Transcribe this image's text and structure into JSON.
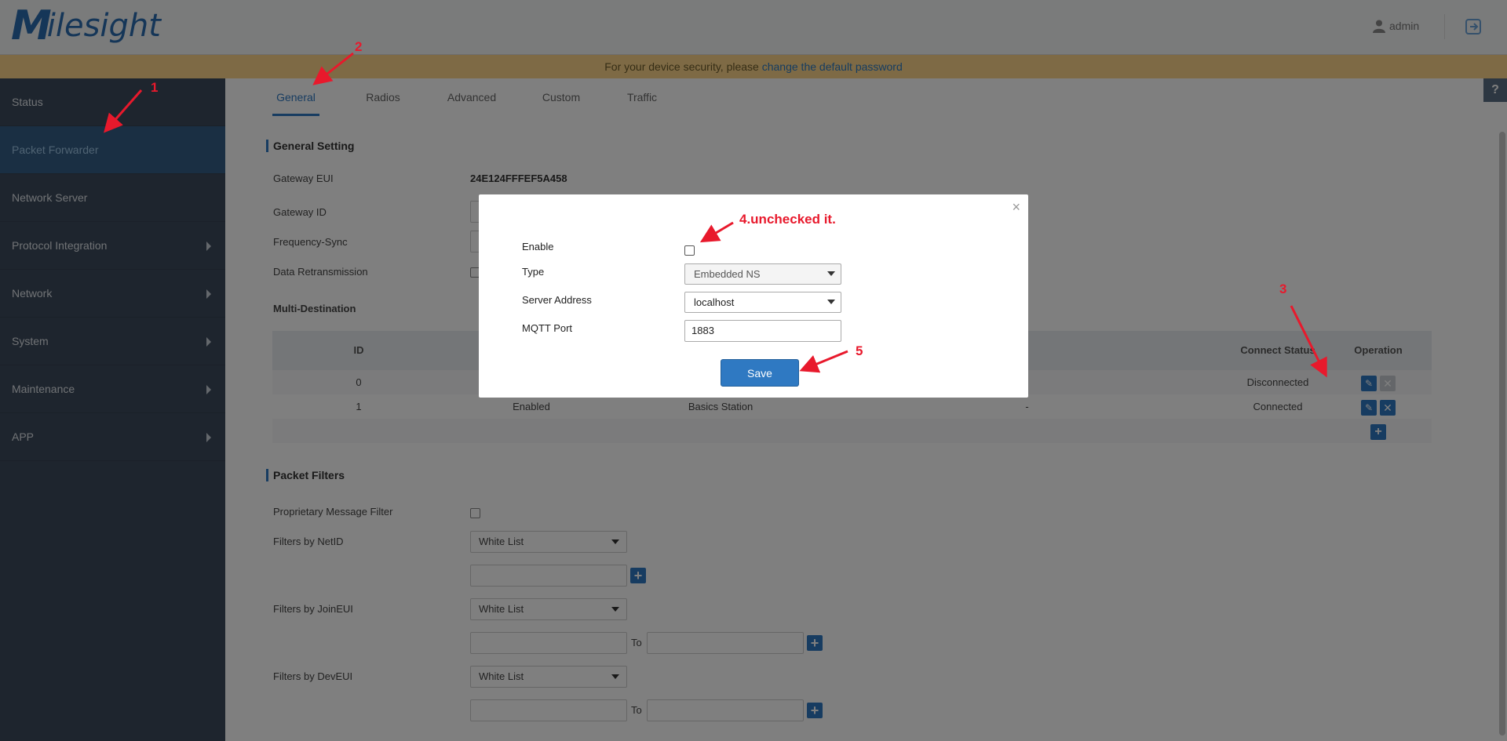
{
  "header": {
    "logo_letter": "M",
    "logo_rest": "ilesight",
    "user": "admin"
  },
  "notice": {
    "text": "For your device security, please ",
    "link": "change the default password"
  },
  "sidebar": {
    "items": [
      {
        "label": "Status"
      },
      {
        "label": "Packet Forwarder"
      },
      {
        "label": "Network Server"
      },
      {
        "label": "Protocol Integration"
      },
      {
        "label": "Network"
      },
      {
        "label": "System"
      },
      {
        "label": "Maintenance"
      },
      {
        "label": "APP"
      }
    ]
  },
  "tabs": [
    {
      "label": "General"
    },
    {
      "label": "Radios"
    },
    {
      "label": "Advanced"
    },
    {
      "label": "Custom"
    },
    {
      "label": "Traffic"
    }
  ],
  "help": "?",
  "general": {
    "title": "General Setting",
    "gateway_eui_label": "Gateway EUI",
    "gateway_eui_value": "24E124FFFEF5A458",
    "gateway_id_label": "Gateway ID",
    "frequency_sync_label": "Frequency-Sync",
    "data_retransmission_label": "Data Retransmission"
  },
  "multi": {
    "title": "Multi-Destination",
    "columns": {
      "id": "ID",
      "connect_status": "Connect Status",
      "operation": "Operation"
    },
    "rows": [
      {
        "id": "0",
        "enable": "",
        "type": "",
        "address": "",
        "status": "Disconnected"
      },
      {
        "id": "1",
        "enable": "Enabled",
        "type": "Basics Station",
        "address": "-",
        "status": "Connected"
      }
    ]
  },
  "filters": {
    "title": "Packet Filters",
    "proprietary_label": "Proprietary Message Filter",
    "netid_label": "Filters by NetID",
    "netid_mode": "White List",
    "joineui_label": "Filters by JoinEUI",
    "joineui_mode": "White List",
    "deveui_label": "Filters by DevEUI",
    "deveui_mode": "White List",
    "to_label": "To"
  },
  "modal": {
    "close": "×",
    "enable_label": "Enable",
    "type_label": "Type",
    "type_value": "Embedded NS",
    "server_label": "Server Address",
    "server_value": "localhost",
    "mqtt_label": "MQTT Port",
    "mqtt_value": "1883",
    "save_label": "Save"
  },
  "annotations": {
    "step1": "1",
    "step2": "2",
    "step3": "3",
    "step4": "4.unchecked it.",
    "step5": "5",
    "color": "#e8192c"
  }
}
